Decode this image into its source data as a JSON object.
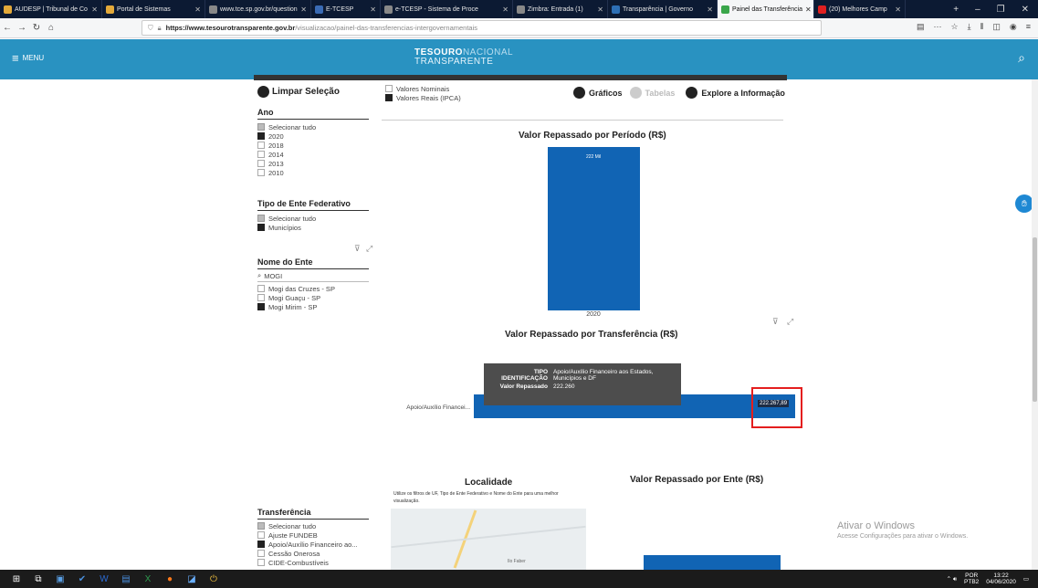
{
  "browser": {
    "tabs": [
      {
        "label": "AUDESP | Tribunal de Co",
        "icon_color": "#e3a93a",
        "active": false
      },
      {
        "label": "Portal de Sistemas",
        "icon_color": "#e3a93a",
        "active": false
      },
      {
        "label": "www.tce.sp.gov.br/question",
        "icon_color": "#888888",
        "active": false
      },
      {
        "label": "E-TCESP",
        "icon_color": "#3a6bb5",
        "active": false
      },
      {
        "label": "e-TCESP - Sistema de Proce",
        "icon_color": "#888888",
        "active": false
      },
      {
        "label": "Zimbra: Entrada (1)",
        "icon_color": "#888888",
        "active": false
      },
      {
        "label": "Transparência | Governo",
        "icon_color": "#2d6fb5",
        "active": false
      },
      {
        "label": "Painel das Transferência",
        "icon_color": "#3aa64a",
        "active": true
      },
      {
        "label": "(20) Melhores Camp",
        "icon_color": "#e02020",
        "active": false
      }
    ],
    "url_host": "https://www.tesourotransparente.gov.br",
    "url_path": "/visualizacao/painel-das-transferencias-intergovernamentais",
    "new_tab": "+",
    "min": "–",
    "max": "❐",
    "close": "✕",
    "more": "···"
  },
  "header": {
    "menu_label": "MENU",
    "logo_line1_bold": "TESOURO",
    "logo_line1_rest": "NACIONAL",
    "logo_line2": "TRANSPARENTE"
  },
  "left_panel": {
    "clear_selection": "Limpar Seleção",
    "ano_title": "Ano",
    "ano_items": [
      {
        "label": "Selecionar tudo",
        "state": "part"
      },
      {
        "label": "2020",
        "state": "on"
      },
      {
        "label": "2018",
        "state": "off"
      },
      {
        "label": "2014",
        "state": "off"
      },
      {
        "label": "2013",
        "state": "off"
      },
      {
        "label": "2010",
        "state": "off"
      }
    ],
    "tipo_title": "Tipo de Ente Federativo",
    "tipo_items": [
      {
        "label": "Selecionar tudo",
        "state": "part"
      },
      {
        "label": "Municípios",
        "state": "on"
      }
    ],
    "nome_title": "Nome do Ente",
    "nome_search": "MOGI",
    "nome_items": [
      {
        "label": "Mogi das Cruzes - SP",
        "state": "off"
      },
      {
        "label": "Mogi Guaçu - SP",
        "state": "off"
      },
      {
        "label": "Mogi Mirim - SP",
        "state": "on"
      }
    ],
    "transf_title": "Transferência",
    "transf_items": [
      {
        "label": "Selecionar tudo",
        "state": "part"
      },
      {
        "label": "Ajuste FUNDEB",
        "state": "off"
      },
      {
        "label": "Apoio/Auxílio Financeiro ao...",
        "state": "on"
      },
      {
        "label": "Cessão Onerosa",
        "state": "off"
      },
      {
        "label": "CIDE-Combustíveis",
        "state": "off"
      }
    ]
  },
  "valores": {
    "nominais": "Valores Nominais",
    "reais": "Valores Reais (IPCA)"
  },
  "view_tabs": {
    "graficos": "Gráficos",
    "tabelas": "Tabelas",
    "explore": "Explore a Informação"
  },
  "charts": {
    "periodo_title": "Valor Repassado por Período (R$)",
    "periodo_bar_label": "222 Mil",
    "periodo_x_label": "2020",
    "transf_title": "Valor Repassado por Transferência (R$)",
    "transf_y_label": "Apoio/Auxílio Financei...",
    "transf_value": "222.267,89",
    "tooltip_k1": "TIPO IDENTIFICAÇÃO",
    "tooltip_v1": "Apoio/Auxílio Financeiro aos Estados, Municípios e DF",
    "tooltip_k2": "Valor Repassado",
    "tooltip_v2": "222.260",
    "localidade_title": "Localidade",
    "localidade_note": "Utilize os filtros de UF, Tipo de Ente Federativo e Nome do Ente para uma melhor visualização.",
    "map_label": "Ilo Faber",
    "ente_title": "Valor Repassado por Ente (R$)"
  },
  "chart_data": [
    {
      "type": "bar",
      "title": "Valor Repassado por Período (R$)",
      "categories": [
        "2020"
      ],
      "values": [
        222000
      ],
      "data_labels": [
        "222 Mil"
      ]
    },
    {
      "type": "bar",
      "title": "Valor Repassado por Transferência (R$)",
      "orientation": "horizontal",
      "categories": [
        "Apoio/Auxílio Financei..."
      ],
      "values": [
        222267.89
      ],
      "data_labels": [
        "222.267,89"
      ]
    }
  ],
  "watermark": {
    "line1": "Ativar o Windows",
    "line2": "Acesse Configurações para ativar o Windows."
  },
  "taskbar": {
    "lang1": "POR",
    "lang2": "PTB2",
    "time": "13:22",
    "date": "04/06/2020"
  }
}
